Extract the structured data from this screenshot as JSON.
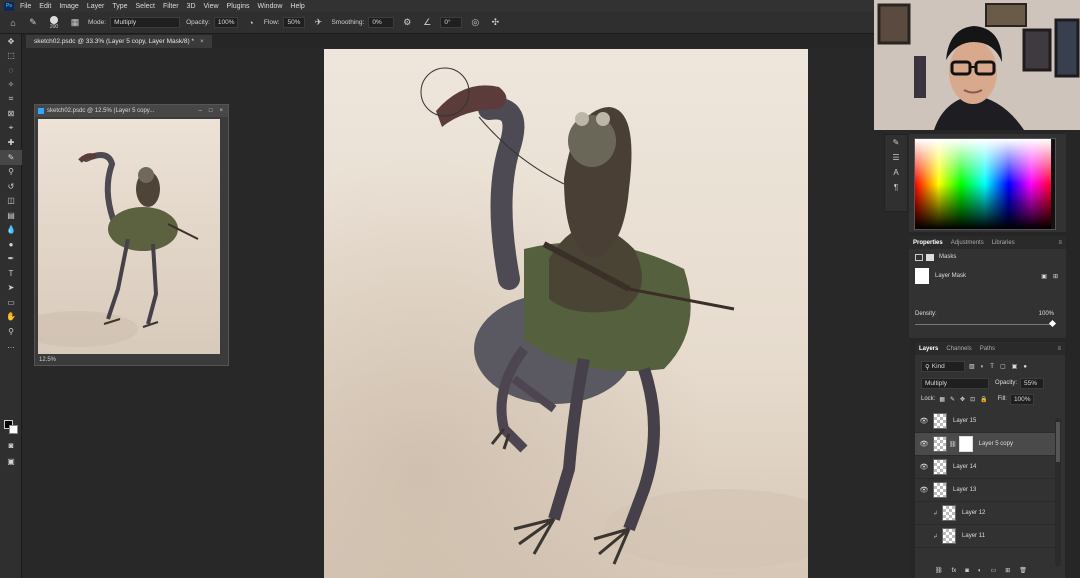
{
  "menu": [
    "File",
    "Edit",
    "Image",
    "Layer",
    "Type",
    "Select",
    "Filter",
    "3D",
    "View",
    "Plugins",
    "Window",
    "Help"
  ],
  "app_logo": "Ps",
  "options": {
    "brush_size": "200",
    "mode_label": "Mode:",
    "mode_value": "Multiply",
    "opacity_label": "Opacity:",
    "opacity_value": "100%",
    "flow_label": "Flow:",
    "flow_value": "50%",
    "smoothing_label": "Smoothing:",
    "smoothing_value": "0%",
    "angle_value": "0°"
  },
  "document_tab": {
    "title": "sketch02.psdc @ 33.3% (Layer 5 copy, Layer Mask/8) *",
    "close": "×"
  },
  "floating_window": {
    "title": "sketch02.psdc @ 12.5% (Layer 5 copy...",
    "controls": [
      "–",
      "□",
      "×"
    ],
    "zoom": "12.5%"
  },
  "properties": {
    "tabs": [
      "Properties",
      "Adjustments",
      "Libraries"
    ],
    "masks_label": "Masks",
    "layer_mask_label": "Layer Mask",
    "density_label": "Density:",
    "density_value": "100%"
  },
  "layers": {
    "tabs": [
      "Layers",
      "Channels",
      "Paths"
    ],
    "filter_kind": "Kind",
    "blend_mode": "Multiply",
    "opacity_label": "Opacity:",
    "opacity_value": "55%",
    "lock_label": "Lock:",
    "fill_label": "Fill:",
    "fill_value": "100%",
    "items": [
      {
        "name": "Layer 15",
        "visible": true
      },
      {
        "name": "Layer 5 copy",
        "visible": true,
        "selected": true
      },
      {
        "name": "Layer 14",
        "visible": true
      },
      {
        "name": "Layer 13",
        "visible": true
      },
      {
        "name": "Layer 12",
        "visible": false
      },
      {
        "name": "Layer 11",
        "visible": false
      }
    ]
  },
  "colors": {
    "canvas_bg": "#e9ddd0",
    "accent": "#31a8ff"
  }
}
